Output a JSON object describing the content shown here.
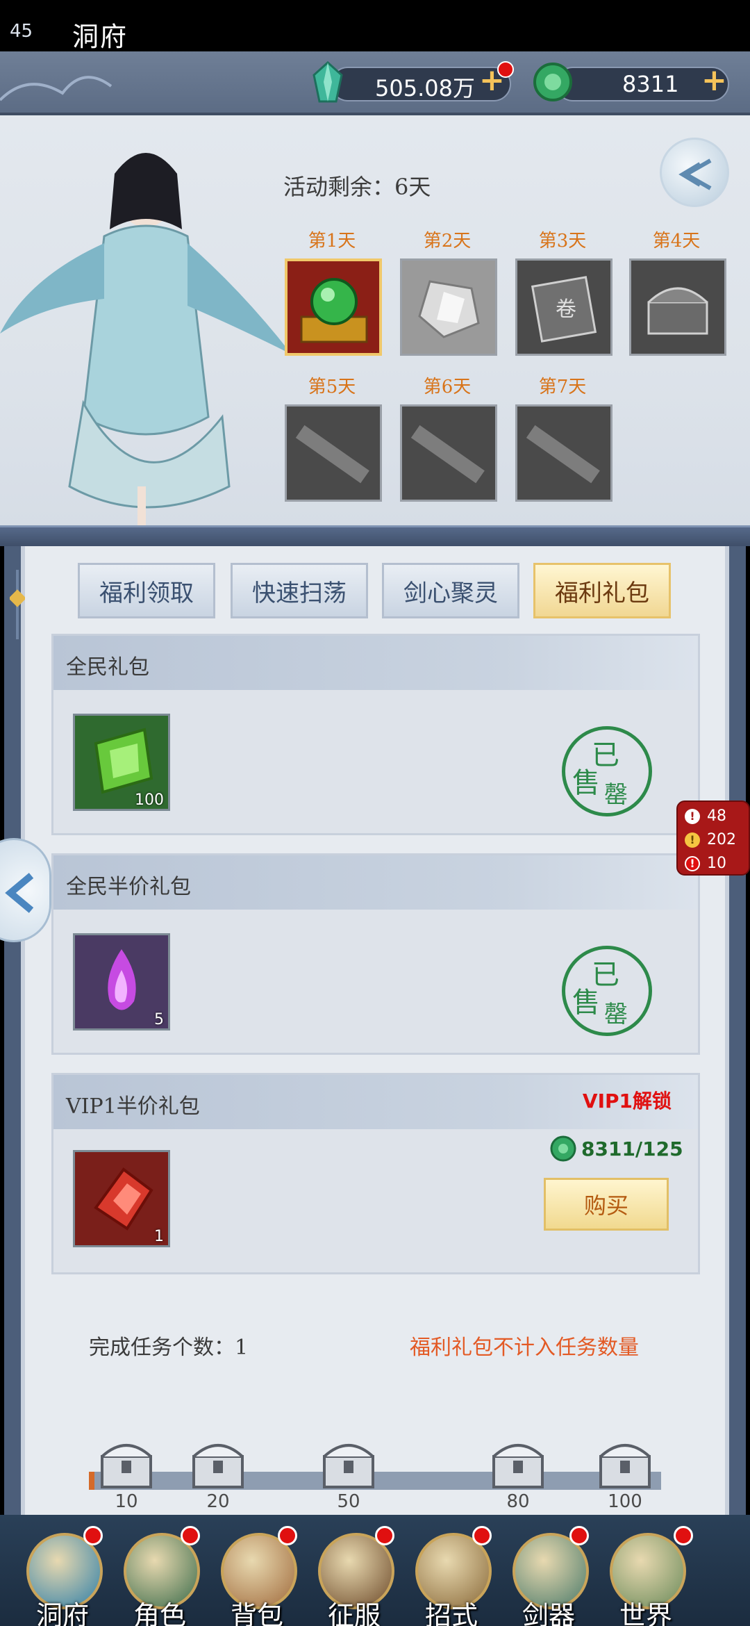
{
  "header": {
    "level": "45",
    "title": "洞府",
    "resource1": {
      "value": "505.08万",
      "icon": "jade-crystal-icon"
    },
    "resource2": {
      "value": "8311",
      "icon": "jade-coin-icon"
    },
    "plus": "+"
  },
  "event": {
    "remaining": "活动剩余：6天",
    "days": [
      {
        "label": "第1天",
        "item": "jade-orb-icon"
      },
      {
        "label": "第2天",
        "item": "silver-gem-icon"
      },
      {
        "label": "第3天",
        "item": "manual-book-icon"
      },
      {
        "label": "第4天",
        "item": "treasure-chest-icon"
      },
      {
        "label": "第5天",
        "item": "scroll-icon"
      },
      {
        "label": "第6天",
        "item": "scroll-icon"
      },
      {
        "label": "第7天",
        "item": "scroll-icon"
      }
    ]
  },
  "tabs": [
    "福利领取",
    "快速扫荡",
    "剑心聚灵",
    "福利礼包"
  ],
  "cards": [
    {
      "title": "全民礼包",
      "count": "100",
      "status_a": "已",
      "status_b": "售",
      "status_c": "罄"
    },
    {
      "title": "全民半价礼包",
      "count": "5",
      "status_a": "已",
      "status_b": "售",
      "status_c": "罄"
    },
    {
      "title": "VIP1半价礼包",
      "count": "1",
      "lock": "VIP1解锁",
      "price": "8311/125",
      "buy": "购买"
    }
  ],
  "debug": {
    "info": "48",
    "warn": "202",
    "error": "10"
  },
  "progress": {
    "count_text": "完成任务个数：1",
    "note": "福利礼包不计入任务数量",
    "value": 1,
    "max": 100,
    "milestones": [
      "10",
      "20",
      "50",
      "80",
      "100"
    ]
  },
  "nav": [
    "洞府",
    "角色",
    "背包",
    "征服",
    "招式",
    "剑器",
    "世界"
  ],
  "colors": {
    "accent": "#d8741a",
    "soldout": "#2d8a4a",
    "alert": "#e01010"
  }
}
